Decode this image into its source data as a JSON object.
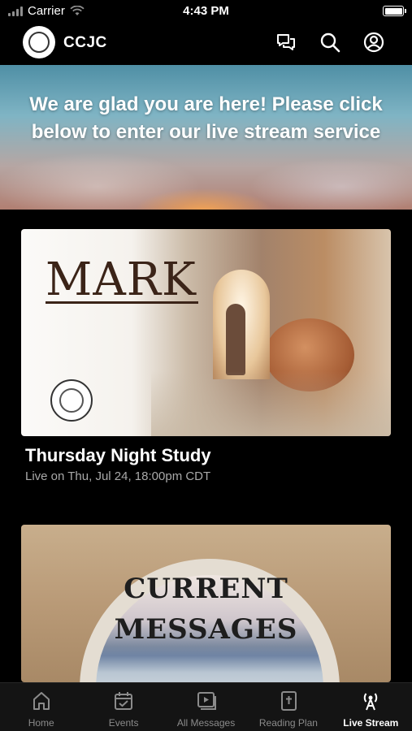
{
  "status_bar": {
    "carrier": "Carrier",
    "time": "4:43 PM"
  },
  "header": {
    "title": "CCJC",
    "icons": [
      "chat-icon",
      "search-icon",
      "account-icon"
    ]
  },
  "banner": {
    "text": "We are glad you are here!  Please click below to enter our live stream service"
  },
  "cards": [
    {
      "image_title": "MARK",
      "title": "Thursday Night Study",
      "subtitle": "Live on Thu, Jul 24, 18:00pm CDT"
    },
    {
      "image_lines": [
        "CURRENT",
        "MESSAGES"
      ]
    }
  ],
  "tab_bar": {
    "active": "Live Stream",
    "tabs": [
      {
        "label": "Home",
        "icon": "home-icon"
      },
      {
        "label": "Events",
        "icon": "calendar-icon"
      },
      {
        "label": "All Messages",
        "icon": "video-icon"
      },
      {
        "label": "Reading Plan",
        "icon": "bible-icon"
      },
      {
        "label": "Live Stream",
        "icon": "broadcast-icon"
      }
    ]
  },
  "colors": {
    "background": "#000000",
    "tab_bar": "#141414",
    "inactive_tab": "#8b8b8b",
    "subtitle": "#a9a9a9"
  }
}
